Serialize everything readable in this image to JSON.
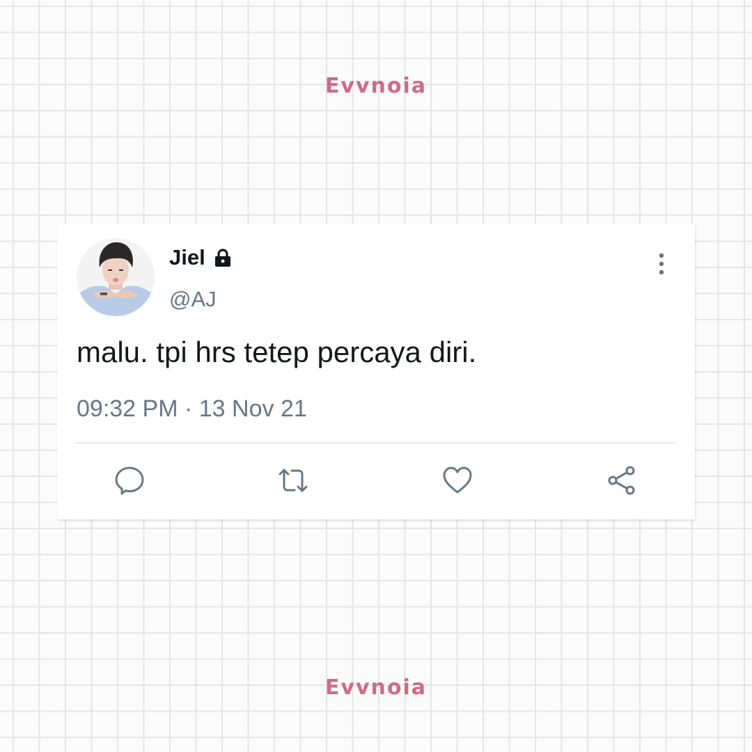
{
  "brand": {
    "top": "Evvnoia",
    "bottom": "Evvnoia"
  },
  "tweet": {
    "display_name": "Jiel",
    "handle": "@AJ",
    "text": "malu. tpi hrs tetep percaya diri.",
    "time": "09:32 PM",
    "separator": "·",
    "date": "13 Nov 21"
  },
  "icons": {
    "lock": "lock-icon",
    "more": "more-vertical-icon",
    "reply": "reply-icon",
    "retweet": "retweet-icon",
    "like": "heart-icon",
    "share": "share-icon"
  },
  "colors": {
    "brand": "#cf6b86",
    "text": "#14171a",
    "secondary": "#657786",
    "divider": "#e4e8eb"
  }
}
